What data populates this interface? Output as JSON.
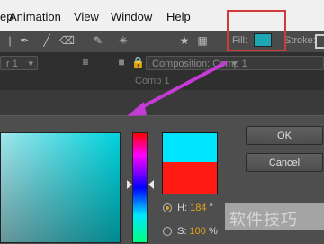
{
  "menu": {
    "partial_left": "ep",
    "items": [
      "Animation",
      "View",
      "Window",
      "Help"
    ]
  },
  "toolbar": {
    "fill_label": "Fill:",
    "stroke_label": "Stroke:",
    "fill_color": "#1ea6b3",
    "icons": [
      "pen-tool-icon",
      "brush-tool-icon",
      "eraser-tool-icon",
      "puppet-tool-icon",
      "pin-tool-icon",
      "star-icon",
      "grid-icon"
    ]
  },
  "panels": {
    "left_tab": "r 1",
    "composition_tab": "Composition: Comp 1",
    "composition_sub": "Comp 1"
  },
  "picker": {
    "ok_label": "OK",
    "cancel_label": "Cancel",
    "new_color": "#00e5ff",
    "old_color": "#ff1a14",
    "h_label": "H:",
    "h_value": "184",
    "h_unit": "°",
    "s_label": "S:",
    "s_value": "100",
    "s_unit": "%"
  },
  "annotation": {
    "highlight_color": "#d23a3a",
    "arrow_color": "#c43bd6"
  },
  "watermark": "软件技巧"
}
